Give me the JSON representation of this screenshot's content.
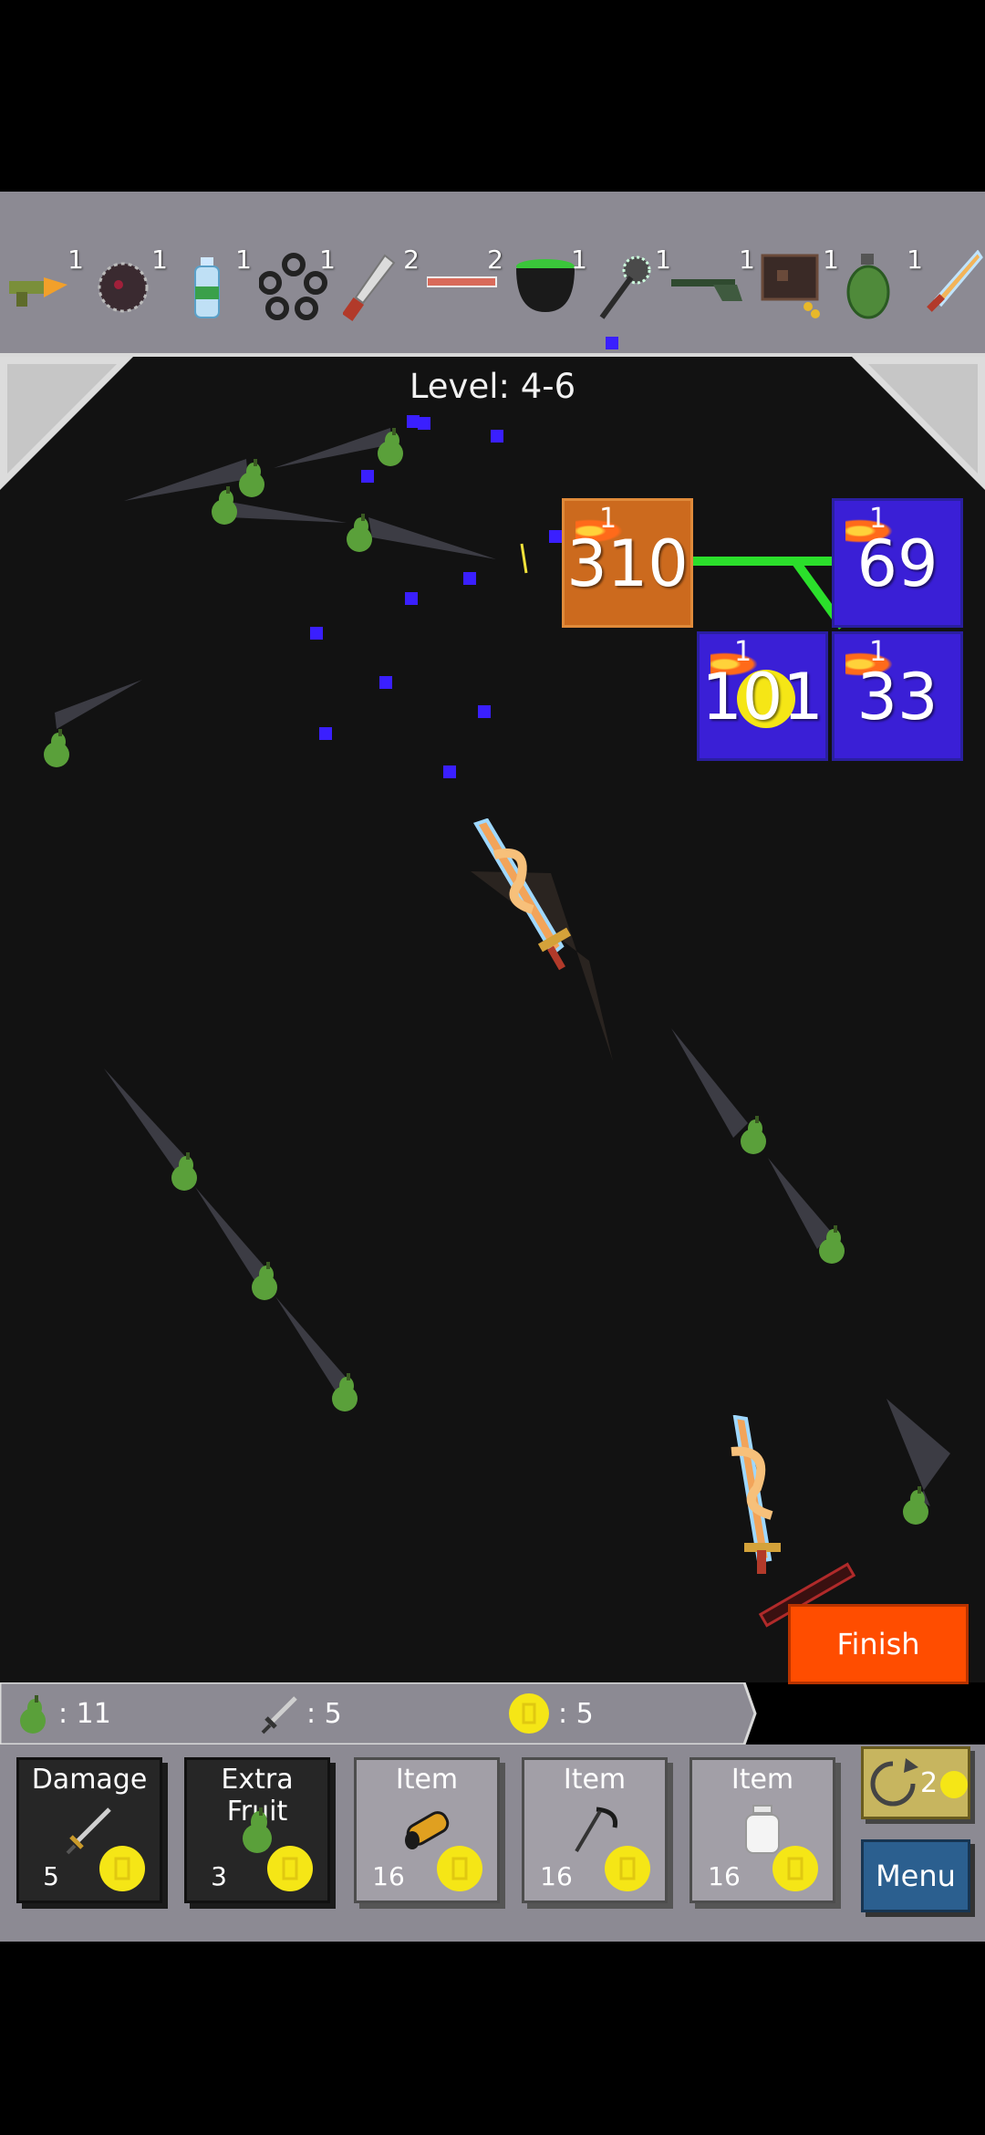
{
  "inventory": [
    {
      "icon": "carrot-gun-icon",
      "count": "1"
    },
    {
      "icon": "spiked-bomb-icon",
      "count": "1"
    },
    {
      "icon": "water-bottle-icon",
      "count": "1"
    },
    {
      "icon": "ring-chain-icon",
      "count": "1"
    },
    {
      "icon": "machete-icon",
      "count": "2"
    },
    {
      "icon": "rod-icon",
      "count": "2"
    },
    {
      "icon": "cauldron-icon",
      "count": "1"
    },
    {
      "icon": "mace-icon",
      "count": "1"
    },
    {
      "icon": "shotgun-icon",
      "count": "1"
    },
    {
      "icon": "wallet-icon",
      "count": "1"
    },
    {
      "icon": "grenade-icon",
      "count": "1"
    },
    {
      "icon": "golden-sword-icon",
      "count": "1"
    }
  ],
  "level": {
    "text": "Level: 4-6"
  },
  "blocks": [
    {
      "value": "310",
      "level": "1",
      "color": "#cc6a1e"
    },
    {
      "value": "69",
      "level": "1",
      "color": "#3a1fd6"
    },
    {
      "value": "101",
      "level": "1",
      "color": "#3a1fd6"
    },
    {
      "value": "33",
      "level": "1",
      "color": "#3a1fd6"
    }
  ],
  "finish": {
    "label": "Finish"
  },
  "stats": {
    "fruit": ": 11",
    "damage": ": 5",
    "coins": ": 5"
  },
  "shop": {
    "cards": [
      {
        "title": "Damage",
        "price": "5",
        "icon": "sword-icon",
        "style": "dark"
      },
      {
        "title": "Extra Fruit",
        "price": "3",
        "icon": "pear-icon",
        "style": "dark"
      },
      {
        "title": "Item",
        "price": "16",
        "icon": "log-icon",
        "style": "light"
      },
      {
        "title": "Item",
        "price": "16",
        "icon": "scythe-icon",
        "style": "light"
      },
      {
        "title": "Item",
        "price": "16",
        "icon": "jar-icon",
        "style": "light"
      }
    ],
    "reroll_count": "2",
    "menu_label": "Menu"
  },
  "colors": {
    "bar_gray": "#8c8a93",
    "field": "#121212",
    "accent_blue": "#3a1fff",
    "finish_orange": "#ff4d00",
    "menu_blue": "#2b5f8f",
    "coin_yellow": "#f5e616"
  }
}
